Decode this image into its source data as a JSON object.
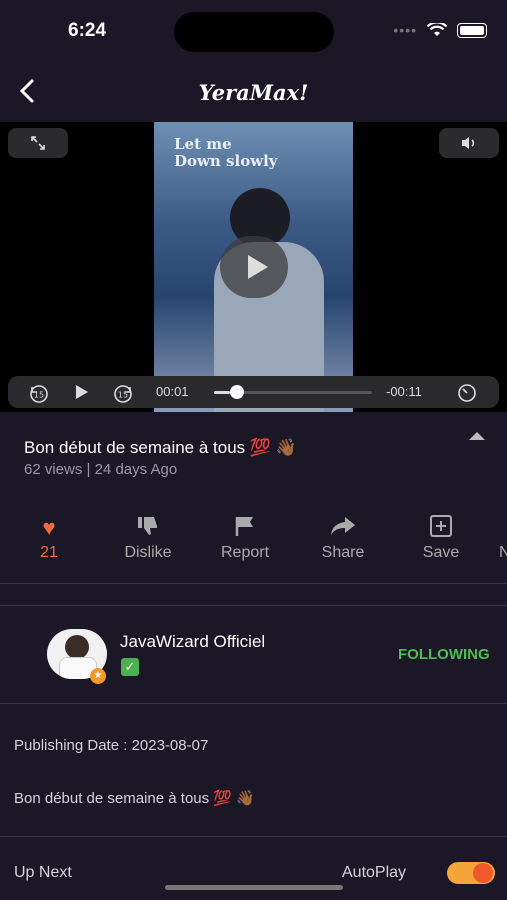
{
  "status": {
    "time": "6:24",
    "dots": "••••",
    "wifi_icon": "wifi-icon",
    "battery_icon": "battery-icon"
  },
  "header": {
    "back_icon": "chevron-left-icon",
    "title": "YeraMax!"
  },
  "player": {
    "caption_line1": "Let me",
    "caption_line2": "Down slowly",
    "expand_icon": "expand-icon",
    "volume_icon": "volume-icon",
    "rewind_label": "15",
    "forward_label": "15",
    "elapsed": "00:01",
    "remaining": "-00:11",
    "progress": 0.1
  },
  "video": {
    "title": "Bon début de semaine à tous 💯 👋🏾",
    "meta": "62 views | 24 days Ago"
  },
  "actions": [
    {
      "label": "21",
      "icon": "heart-icon",
      "glyph": "♥"
    },
    {
      "label": "Dislike",
      "icon": "thumbs-down-icon",
      "glyph": "👎"
    },
    {
      "label": "Report",
      "icon": "flag-icon",
      "glyph": "⚑"
    },
    {
      "label": "Share",
      "icon": "share-icon",
      "glyph": "➦"
    },
    {
      "label": "Save",
      "icon": "add-box-icon",
      "glyph": "⊞"
    }
  ],
  "channel": {
    "name": "JavaWizard Officiel",
    "verified": "✓",
    "follow_label": "FOLLOWING"
  },
  "details": {
    "publishing_date": "Publishing Date : 2023-08-07",
    "description": "Bon début de semaine à tous 💯 👋🏾"
  },
  "footer": {
    "up_next": "Up Next",
    "autoplay": "AutoPlay",
    "autoplay_on": true
  },
  "colors": {
    "accent": "#f06a3e",
    "following": "#4bbf4f",
    "background": "#1b1726"
  }
}
